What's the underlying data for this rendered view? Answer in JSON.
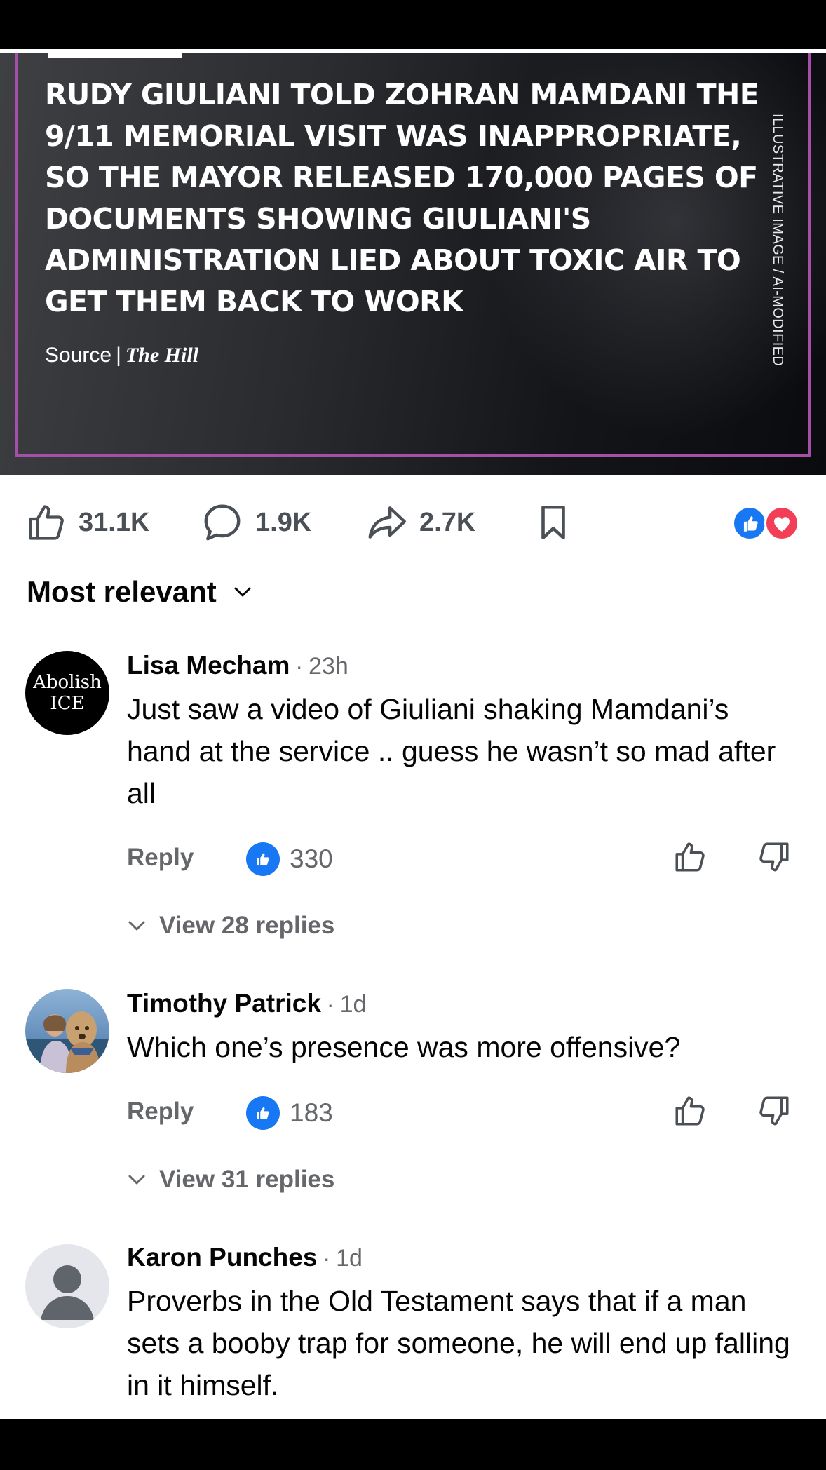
{
  "post": {
    "headline": "RUDY GIULIANI TOLD ZOHRAN MAMDANI THE 9/11 MEMORIAL VISIT WAS INAPPROPRIATE, SO THE MAYOR RELEASED 170,000 PAGES OF DOCUMENTS SHOWING GIULIANI'S ADMINISTRATION LIED ABOUT TOXIC AIR TO GET THEM BACK TO WORK",
    "source_label": "Source",
    "source_separator": "|",
    "source_name": "The Hill",
    "image_label": "ILLUSTRATIVE IMAGE / AI-MODIFIED",
    "frame_color": "#a450a8"
  },
  "actions": {
    "likes": "31.1K",
    "comments": "1.9K",
    "shares": "2.7K",
    "reactions": [
      "like",
      "love"
    ]
  },
  "sort": {
    "label": "Most relevant"
  },
  "comments": [
    {
      "name": "Lisa Mecham",
      "dot": "·",
      "time": "23h",
      "avatar_text_1": "Abolish",
      "avatar_text_2": "ICE",
      "text": "Just saw a video of Giuliani shaking Mamdani’s hand at the service .. guess he wasn’t so mad after all",
      "reply_label": "Reply",
      "likes": "330",
      "view_replies": "View 28 replies"
    },
    {
      "name": "Timothy Patrick",
      "dot": "·",
      "time": "1d",
      "text": "Which one’s presence was more offensive?",
      "reply_label": "Reply",
      "likes": "183",
      "view_replies": "View 31 replies"
    },
    {
      "name": "Karon Punches",
      "dot": "·",
      "time": "1d",
      "text": "Proverbs in the Old Testament says that if a man sets a booby trap for someone, he will end up falling in it himself."
    }
  ],
  "colors": {
    "like_blue": "#1877f2",
    "love_red": "#f33e58",
    "secondary_text": "#65676b"
  }
}
